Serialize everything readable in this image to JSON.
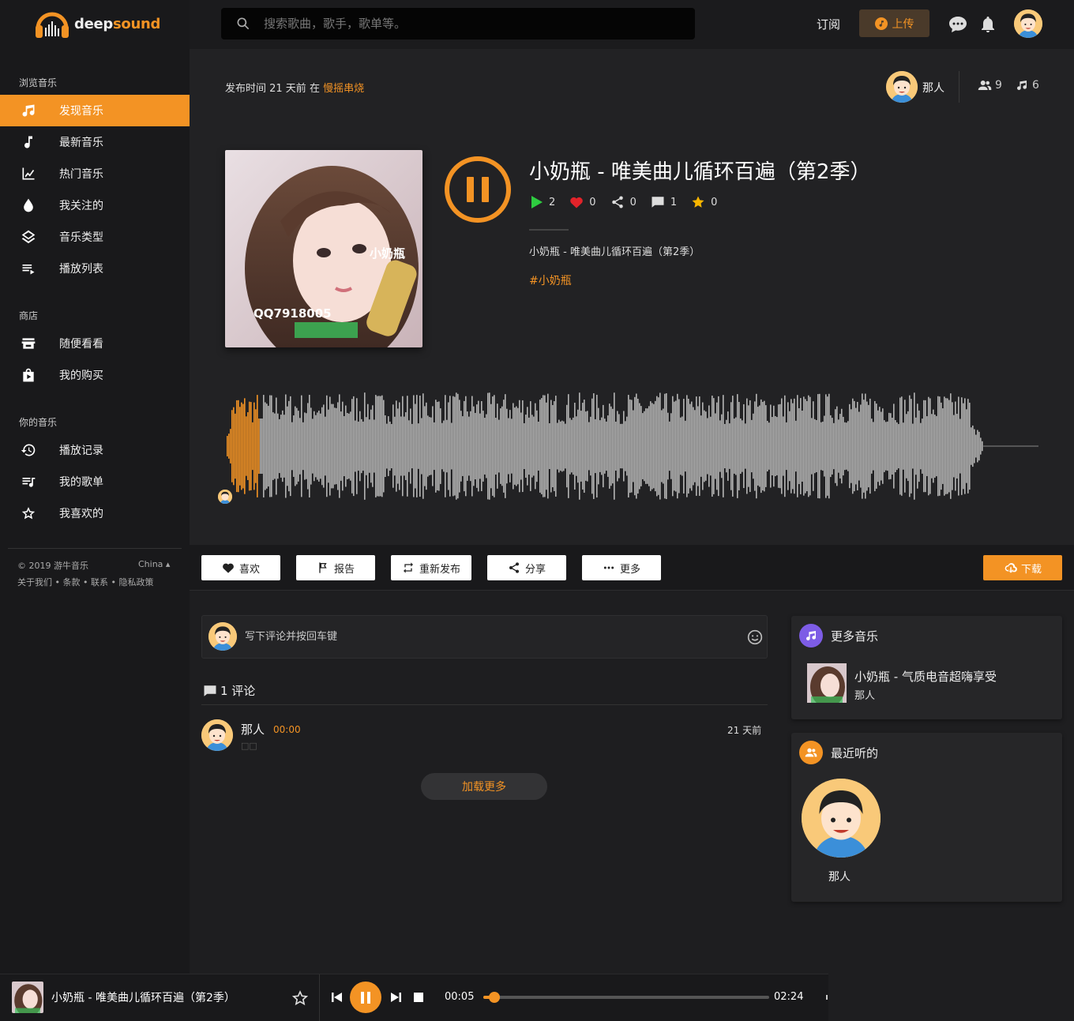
{
  "brand": {
    "name_prefix": "deep",
    "name_suffix": "sound"
  },
  "sidebar": {
    "browse_title": "浏览音乐",
    "browse_items": [
      {
        "label": "发现音乐",
        "icon": "music-notes-icon",
        "active": true
      },
      {
        "label": "最新音乐",
        "icon": "music-note-icon"
      },
      {
        "label": "热门音乐",
        "icon": "trending-chart-icon"
      },
      {
        "label": "我关注的",
        "icon": "drop-icon"
      },
      {
        "label": "音乐类型",
        "icon": "layers-icon"
      },
      {
        "label": "播放列表",
        "icon": "playlist-icon"
      }
    ],
    "store_title": "商店",
    "store_items": [
      {
        "label": "随便看看",
        "icon": "store-icon"
      },
      {
        "label": "我的购买",
        "icon": "shopping-bag-icon"
      }
    ],
    "yours_title": "你的音乐",
    "yours_items": [
      {
        "label": "播放记录",
        "icon": "history-icon"
      },
      {
        "label": "我的歌单",
        "icon": "queue-music-icon"
      },
      {
        "label": "我喜欢的",
        "icon": "star-outline-icon"
      }
    ],
    "copyright": "© 2019 游牛音乐",
    "language": "China ▴",
    "footer_links": "关于我们 • 条款 • 联系 • 隐私政策"
  },
  "header": {
    "search_placeholder": "搜索歌曲，歌手，歌单等。",
    "subscribe": "订阅",
    "upload": "上传"
  },
  "track": {
    "published_prefix": "发布时间 21 天前 在",
    "genre": "慢摇串烧",
    "owner": "那人",
    "followers": "9",
    "tracks": "6",
    "title": "小奶瓶 - 唯美曲儿循环百遍（第2季）",
    "plays": "2",
    "likes": "0",
    "shares": "0",
    "comments": "1",
    "favorites": "0",
    "description": "小奶瓶 - 唯美曲儿循环百遍（第2季）",
    "tag": "#小奶瓶",
    "cover_watermark": "小奶瓶",
    "cover_qq": "QQ7918005"
  },
  "actions": {
    "like": "喜欢",
    "report": "报告",
    "repost": "重新发布",
    "share": "分享",
    "more": "更多",
    "download": "下载"
  },
  "comments": {
    "placeholder": "写下评论并按回车键",
    "count_label": "1 评论",
    "items": [
      {
        "name": "那人",
        "time": "00:00",
        "ago": "21 天前",
        "text": "□□"
      }
    ],
    "load_more": "加载更多"
  },
  "widgets": {
    "more_music": {
      "title": "更多音乐",
      "track_title": "小奶瓶 - 气质电音超嗨享受",
      "track_artist": "那人"
    },
    "recent": {
      "title": "最近听的",
      "user": "那人"
    }
  },
  "player": {
    "title": "小奶瓶 - 唯美曲儿循环百遍（第2季）",
    "current": "00:05",
    "duration": "02:24",
    "progress": 0.04
  },
  "colors": {
    "accent": "#f39324",
    "wave": "#b5b5b5",
    "like": "#e2232a",
    "play": "#2ecc40",
    "star": "#f7b500"
  }
}
